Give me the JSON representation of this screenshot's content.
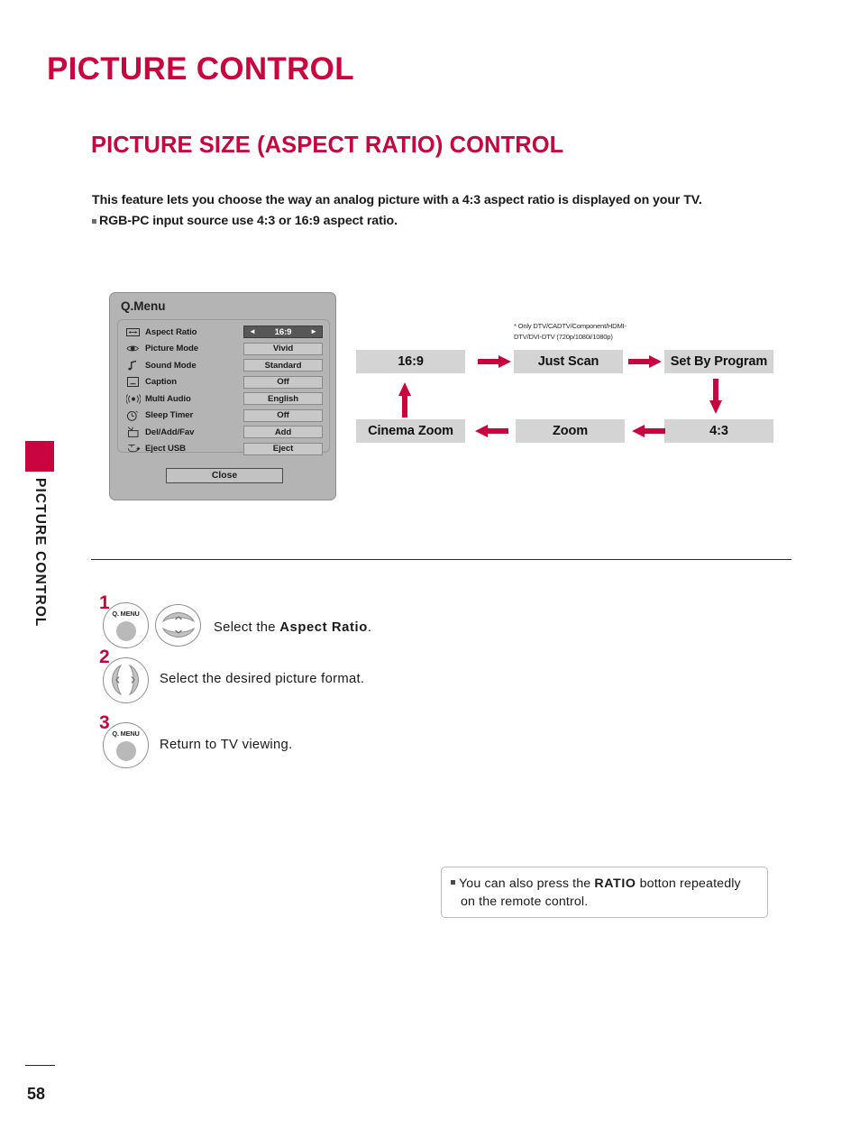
{
  "sidebar": {
    "tab_label": "PICTURE CONTROL",
    "accent_color": "#C8053F"
  },
  "header": {
    "chapter_title": "PICTURE CONTROL",
    "section_title": "PICTURE SIZE (ASPECT RATIO) CONTROL",
    "title_color": "#C8053F"
  },
  "intro": {
    "line1": "This feature lets you choose the way an analog picture with a 4:3 aspect ratio is displayed on your TV.",
    "line2": "RGB-PC input source use 4:3 or 16:9 aspect ratio."
  },
  "qmenu": {
    "title": "Q.Menu",
    "panel_color": "#b4b4b4",
    "selected_value_color": "#575757",
    "rows": [
      {
        "icon": "aspect-ratio-icon",
        "label": "Aspect Ratio",
        "value": "16:9",
        "selected": true,
        "left_arrow": "◄",
        "right_arrow": "►"
      },
      {
        "icon": "eye-icon",
        "label": "Picture Mode",
        "value": "Vivid",
        "selected": false
      },
      {
        "icon": "music-note-icon",
        "label": "Sound Mode",
        "value": "Standard",
        "selected": false
      },
      {
        "icon": "caption-icon",
        "label": "Caption",
        "value": "Off",
        "selected": false
      },
      {
        "icon": "speaker-waves-icon",
        "label": "Multi Audio",
        "value": "English",
        "selected": false
      },
      {
        "icon": "clock-icon",
        "label": "Sleep Timer",
        "value": "Off",
        "selected": false
      },
      {
        "icon": "tv-antenna-icon",
        "label": "Del/Add/Fav",
        "value": "Add",
        "selected": false
      },
      {
        "icon": "usb-eject-icon",
        "label": "Eject USB",
        "value": "Eject",
        "selected": false
      }
    ],
    "close_label": "Close"
  },
  "flow_diagram": {
    "footnote_line1": "* Only DTV/CADTV/Component/HDMI-",
    "footnote_line2": "DTV/DVI-DTV (720p/1080i/1080p)",
    "arrow_color": "#C8053F",
    "box_color": "#d4d4d4",
    "boxes": [
      {
        "name": "flow-box-16-9",
        "label": "16:9"
      },
      {
        "name": "flow-box-just-scan",
        "label": "Just Scan"
      },
      {
        "name": "flow-box-set-by-program",
        "label": "Set By  Program"
      },
      {
        "name": "flow-box-4-3",
        "label": "4:3"
      },
      {
        "name": "flow-box-zoom",
        "label": "Zoom"
      },
      {
        "name": "flow-box-cinema-zoom",
        "label": "Cinema Zoom"
      }
    ]
  },
  "steps": [
    {
      "number": "1",
      "button_label": "Q. MENU",
      "nav": "up-down",
      "text_before": "Select the ",
      "text_bold": "Aspect Ratio",
      "text_after": "."
    },
    {
      "number": "2",
      "nav": "left-right",
      "text": "Select the desired picture format."
    },
    {
      "number": "3",
      "button_label": "Q. MENU",
      "text": "Return to TV viewing."
    }
  ],
  "note": {
    "text_before": "You can also press the ",
    "text_bold": "RATIO",
    "text_after": " botton repeatedly on the remote control.",
    "border_color": "#f0a898"
  },
  "footer": {
    "page_number": "58"
  }
}
